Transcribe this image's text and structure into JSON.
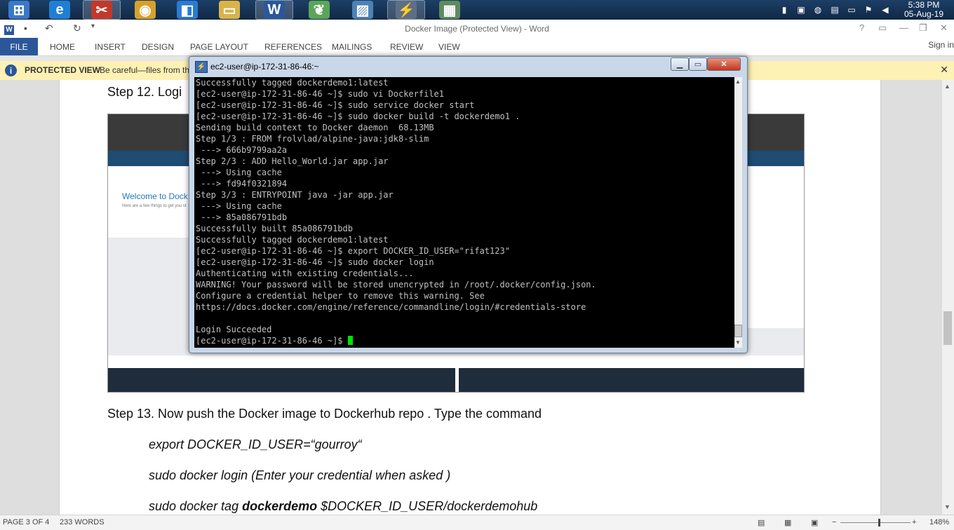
{
  "taskbar": {
    "apps": [
      {
        "name": "Start",
        "glyph": "⊞",
        "color": "#3a78c8"
      },
      {
        "name": "Internet Explorer",
        "glyph": "e",
        "color": "#1f7fd4"
      },
      {
        "name": "Snipping Tool",
        "glyph": "✂",
        "color": "#c0392b"
      },
      {
        "name": "Chrome",
        "glyph": "◉",
        "color": "#d6a12b"
      },
      {
        "name": "Visual Studio Code",
        "glyph": "◧",
        "color": "#2b7bd1"
      },
      {
        "name": "File Explorer",
        "glyph": "▭",
        "color": "#d9b34a"
      },
      {
        "name": "Word",
        "glyph": "W",
        "color": "#2b579a"
      },
      {
        "name": "Spring Tool Suite",
        "glyph": "❦",
        "color": "#5aa55a"
      },
      {
        "name": "Picture Viewer",
        "glyph": "▨",
        "color": "#4c82b5"
      },
      {
        "name": "PuTTY",
        "glyph": "⚡",
        "color": "#5d6f86"
      },
      {
        "name": "Network Tool",
        "glyph": "▦",
        "color": "#5e8a5e"
      }
    ],
    "clock_time": "5:38 PM",
    "clock_date": "05-Aug-19"
  },
  "word": {
    "title": "Docker Image (Protected View) - Word",
    "file_tab": "FILE",
    "tabs": [
      "HOME",
      "INSERT",
      "DESIGN",
      "PAGE LAYOUT",
      "REFERENCES",
      "MAILINGS",
      "REVIEW",
      "VIEW"
    ],
    "sign_in": "Sign in",
    "protected_view": {
      "title": "PROTECTED VIEW",
      "message": "Be careful—files from the"
    }
  },
  "document": {
    "step12_heading": "Step 12. Logi",
    "embedded_shot": {
      "welcome": "Welcome to Dock",
      "subtext": "Here are a few things to get you st"
    },
    "step13": "Step 13. Now push the Docker image to Dockerhub repo . Type the command",
    "cmd1": "export DOCKER_ID_USER=“gourroy“",
    "cmd2": "sudo docker login (Enter your credential when asked )",
    "cmd3_prefix": "sudo docker tag ",
    "cmd3_bold": "dockerdemo",
    "cmd3_suffix": " $DOCKER_ID_USER/dockerdemohub"
  },
  "terminal": {
    "title": "ec2-user@ip-172-31-86-46:~",
    "lines": [
      "Successfully tagged dockerdemo1:latest",
      "[ec2-user@ip-172-31-86-46 ~]$ sudo vi Dockerfile1",
      "[ec2-user@ip-172-31-86-46 ~]$ sudo service docker start",
      "[ec2-user@ip-172-31-86-46 ~]$ sudo docker build -t dockerdemo1 .",
      "Sending build context to Docker daemon  68.13MB",
      "Step 1/3 : FROM frolvlad/alpine-java:jdk8-slim",
      " ---> 666b9799aa2a",
      "Step 2/3 : ADD Hello_World.jar app.jar",
      " ---> Using cache",
      " ---> fd94f0321894",
      "Step 3/3 : ENTRYPOINT java -jar app.jar",
      " ---> Using cache",
      " ---> 85a086791bdb",
      "Successfully built 85a086791bdb",
      "Successfully tagged dockerdemo1:latest",
      "[ec2-user@ip-172-31-86-46 ~]$ export DOCKER_ID_USER=\"rifat123\"",
      "[ec2-user@ip-172-31-86-46 ~]$ sudo docker login",
      "Authenticating with existing credentials...",
      "WARNING! Your password will be stored unencrypted in /root/.docker/config.json.",
      "Configure a credential helper to remove this warning. See",
      "https://docs.docker.com/engine/reference/commandline/login/#credentials-store",
      "",
      "Login Succeeded"
    ],
    "prompt": "[ec2-user@ip-172-31-86-46 ~]$ "
  },
  "status": {
    "page": "PAGE 3 OF 4",
    "words": "233 WORDS",
    "zoom": "148%"
  }
}
